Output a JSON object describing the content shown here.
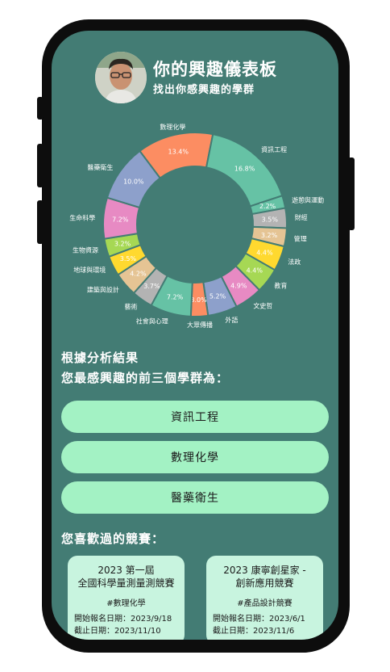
{
  "header": {
    "title": "你的興趣儀表板",
    "subtitle": "找出你感興趣的學群"
  },
  "chart_data": {
    "type": "pie",
    "donut": true,
    "categories": [
      "數理化學",
      "資訊工程",
      "遊憩與運動",
      "財經",
      "管理",
      "法政",
      "教育",
      "文史哲",
      "外語",
      "大眾傳播",
      "社會與心理",
      "藝術",
      "建築與設計",
      "地球與環境",
      "生物資源",
      "生命科學",
      "醫藥衛生"
    ],
    "values": [
      13.4,
      16.8,
      2.2,
      3.5,
      3.2,
      4.4,
      4.4,
      4.9,
      5.2,
      3.0,
      7.2,
      3.7,
      4.2,
      3.5,
      3.2,
      7.2,
      10.0
    ],
    "value_labels": [
      "13.4%",
      "16.8%",
      "2.2%",
      "3.5%",
      "3.2%",
      "4.4%",
      "4.4%",
      "4.9%",
      "5.2%",
      "3.0%",
      "7.2%",
      "3.7%",
      "4.2%",
      "3.5%",
      "3.2%",
      "7.2%",
      "10.0%"
    ],
    "colors": [
      "#fc8d62",
      "#66c2a5",
      "#66c2a5",
      "#b3b3b3",
      "#e5c494",
      "#ffd92f",
      "#a6d854",
      "#e78ac3",
      "#8da0cb",
      "#fc8d62",
      "#66c2a5",
      "#b3b3b3",
      "#e5c494",
      "#ffd92f",
      "#a6d854",
      "#e78ac3",
      "#8da0cb"
    ]
  },
  "results": {
    "heading1": "根據分析結果",
    "heading2": "您最感興趣的前三個學群為：",
    "top3": [
      "資訊工程",
      "數理化學",
      "醫藥衛生"
    ]
  },
  "competitions": {
    "heading": "您喜歡過的競賽：",
    "cards": [
      {
        "title1": "2023 第一屆",
        "title2": "全國科學量測量測競賽",
        "tag": "#數理化學",
        "start": "開始報名日期：2023/9/18",
        "end": "截止日期：2023/11/10"
      },
      {
        "title1": "2023 康寧創星家 -",
        "title2": "創新應用競賽",
        "tag": "#產品設計競賽",
        "start": "開始報名日期：2023/6/1",
        "end": "截止日期：2023/11/6"
      }
    ]
  }
}
